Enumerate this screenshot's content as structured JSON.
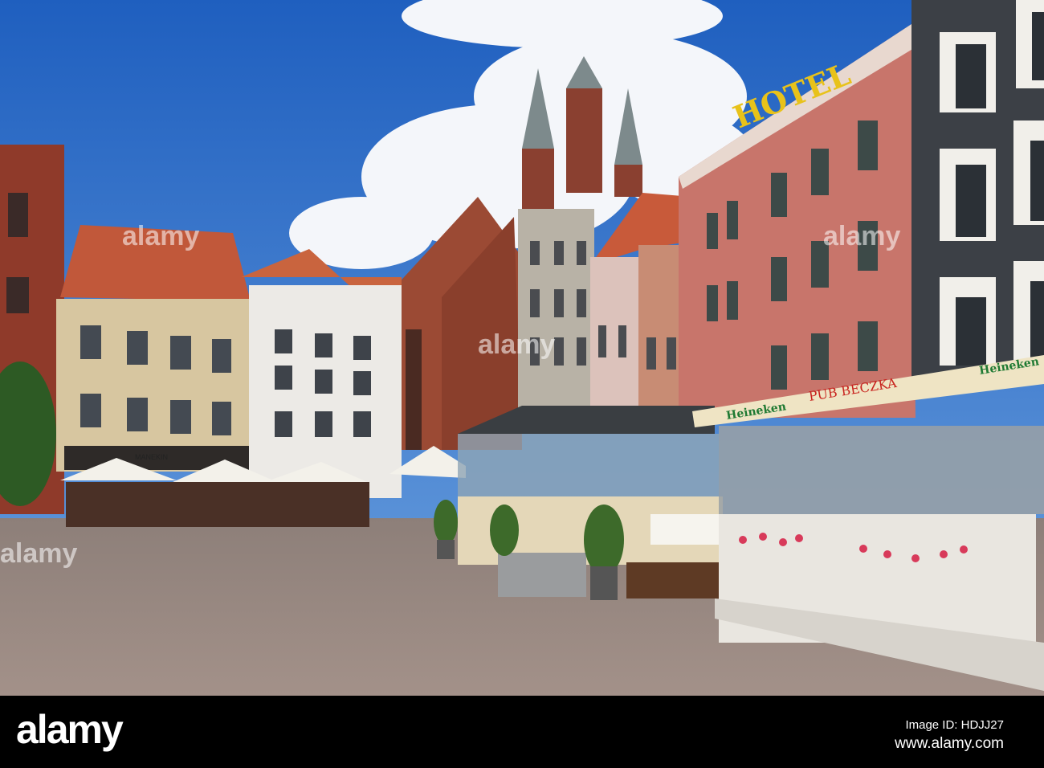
{
  "signs": {
    "hotel": "HOTEL",
    "pub": "PUB BECZKA",
    "heineken_left": "Heineken",
    "heineken_right": "Heineken",
    "shop": "MANEKIN"
  },
  "watermark": {
    "text": "alamy"
  },
  "footer": {
    "logo": "alamy",
    "image_id": "Image ID: HDJJ27",
    "url": "www.alamy.com"
  },
  "colors": {
    "sky": "#2f6fc7",
    "pavement": "#9a8a82",
    "hotel_facade": "#c8756b",
    "footer_bg": "#000000"
  }
}
